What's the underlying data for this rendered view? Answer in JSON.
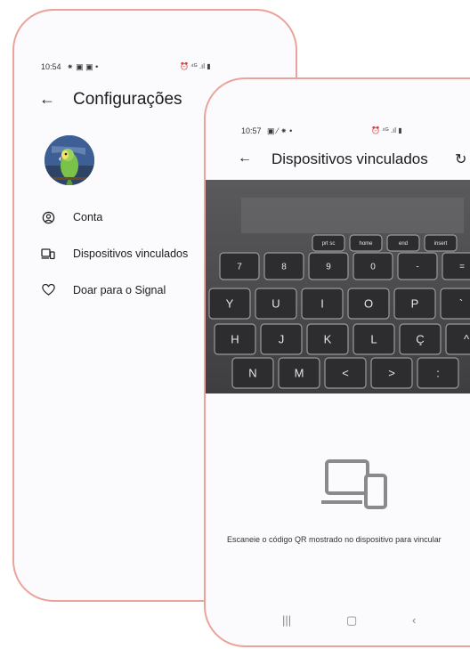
{
  "settings_screen": {
    "status_time": "10:54",
    "title": "Configurações",
    "menu": [
      {
        "label": "Conta",
        "icon": "account-circle-icon"
      },
      {
        "label": "Dispositivos vinculados",
        "icon": "linked-devices-icon"
      },
      {
        "label": "Doar para o Signal",
        "icon": "heart-icon"
      }
    ]
  },
  "linked_devices_screen": {
    "status_time": "10:57",
    "title": "Dispositivos vinculados",
    "scan_instruction": "Escaneie o código QR mostrado no dispositivo para vincular",
    "keyboard_keys": {
      "fn_row": [
        "prt sc",
        "home",
        "end",
        "insert"
      ],
      "num_row": [
        "&",
        "*",
        "(",
        ")",
        "_",
        "+"
      ],
      "num_row_digits": [
        "7",
        "8",
        "9",
        "0",
        "-",
        "="
      ],
      "top_row": [
        "Y",
        "U",
        "I",
        "O",
        "P",
        "`"
      ],
      "home_row": [
        "H",
        "J",
        "K",
        "L",
        "Ç",
        "^"
      ],
      "bottom_row": [
        "N",
        "M",
        "<",
        ">",
        ":"
      ]
    }
  },
  "colors": {
    "frame_border": "#e9a39a",
    "screen_bg": "#fbfbfd"
  }
}
